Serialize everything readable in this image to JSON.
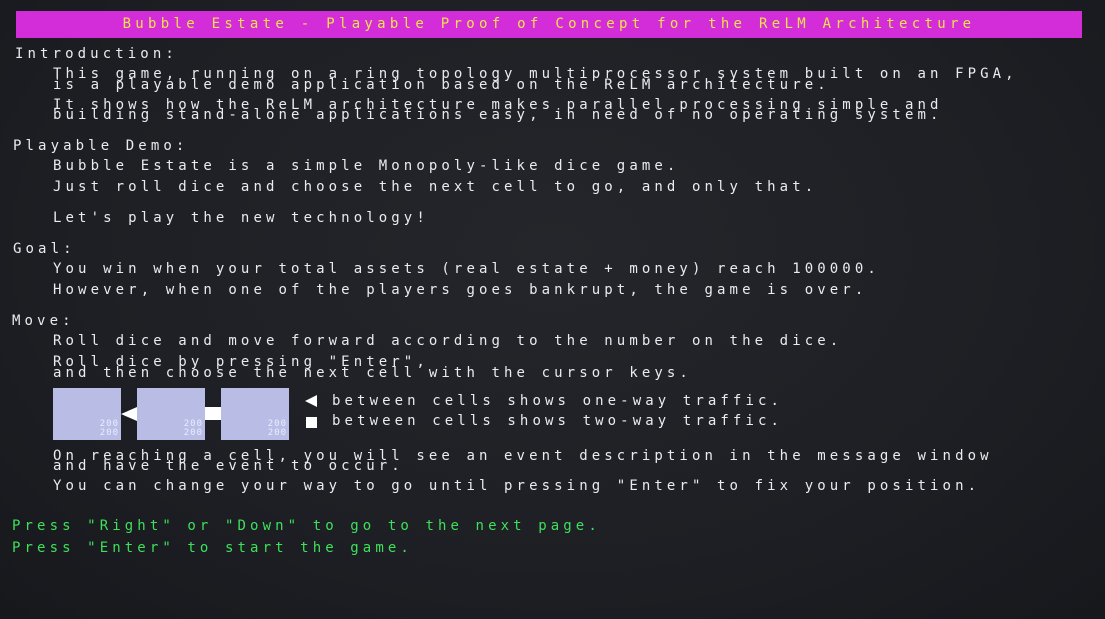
{
  "title": "Bubble Estate - Playable Proof of Concept for the ReLM Architecture",
  "intro": {
    "heading": "Introduction:",
    "lines": [
      "This game, running on a ring topology multiprocessor system built on an FPGA,",
      "is a playable demo application based on the ReLM architecture.",
      "It shows how the ReLM architecture makes parallel processing simple and",
      "building stand-alone applications easy, in need of no operating system."
    ]
  },
  "demo": {
    "heading": "Playable Demo:",
    "lines": [
      "Bubble Estate is a simple Monopoly-like dice game.",
      "Just roll dice and choose the next cell to go, and only that.",
      "Let's play the new technology!"
    ]
  },
  "goal": {
    "heading": "Goal:",
    "lines": [
      "You win when your total assets (real estate + money) reach 100000.",
      "However, when one of the players goes bankrupt, the game is over."
    ]
  },
  "move": {
    "heading": "Move:",
    "lines": [
      "Roll dice and move forward according to the number on the dice.",
      "Roll dice by pressing \"Enter\",",
      "and then choose the next cell with the cursor keys."
    ],
    "cells": [
      {
        "label_top": "200",
        "label_bottom": "200"
      },
      {
        "label_top": "200",
        "label_bottom": "200"
      },
      {
        "label_top": "200",
        "label_bottom": "200"
      }
    ],
    "legend": {
      "one_way": "between cells shows one-way traffic.",
      "two_way": "between cells shows two-way traffic."
    },
    "after_lines": [
      "On reaching a cell, you will see an event description in the message window",
      "and have the event to occur.",
      "You can change your way to go until pressing \"Enter\" to fix your position."
    ]
  },
  "prompts": {
    "next_page": "Press \"Right\" or \"Down\" to go to the next page.",
    "start": "Press \"Enter\" to start the game."
  },
  "colors": {
    "title_bar": "#d22dd8",
    "title_text": "#f2e24a",
    "body_text": "#e9ecef",
    "prompt_text": "#3ee05a",
    "cell_fill": "#b9bde6"
  }
}
